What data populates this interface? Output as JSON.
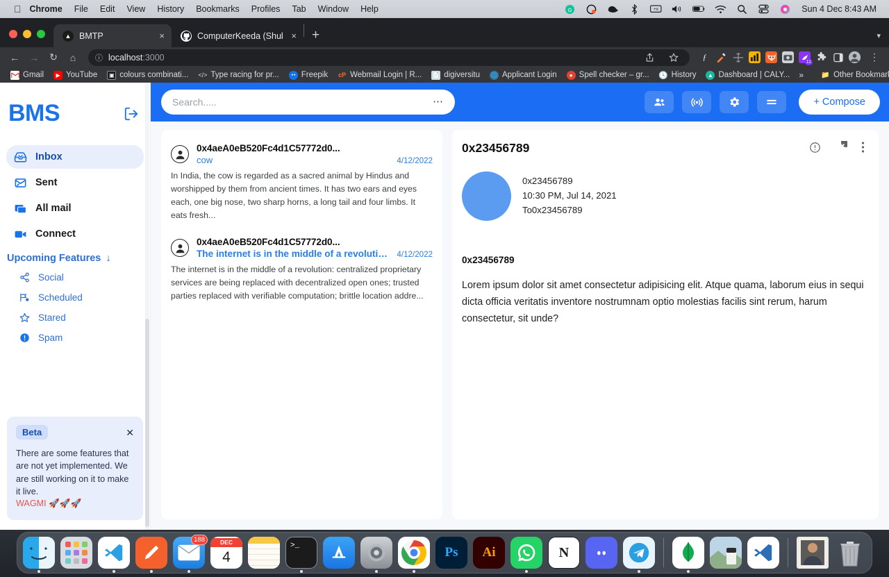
{
  "os": {
    "menu": {
      "apple_icon": "apple-logo-icon",
      "items": [
        "Chrome",
        "File",
        "Edit",
        "View",
        "History",
        "Bookmarks",
        "Profiles",
        "Tab",
        "Window",
        "Help"
      ],
      "status_icons": [
        "grammarly-icon",
        "cleanshot-icon",
        "bluetooth-icon",
        "battery-percent-icon",
        "volume-icon",
        "battery-icon",
        "wifi-icon",
        "spotlight-search-icon",
        "control-center-icon",
        "siri-icon"
      ],
      "clock": "Sun 4 Dec  8:43 AM"
    }
  },
  "browser": {
    "tabs": [
      {
        "title": "BMTP",
        "favicon": "bmtp-triangle-icon",
        "active": true,
        "close": "×"
      },
      {
        "title": "ComputerKeeda (Shubham Sha",
        "favicon": "github-icon",
        "active": false,
        "close": "×"
      }
    ],
    "new_tab_label": "+",
    "nav": {
      "back": "←",
      "forward": "→",
      "reload": "↻",
      "home": "⌂"
    },
    "omnibox": {
      "security_icon": "info-circle-icon",
      "url_host": "localhost",
      "url_rest": ":3000",
      "share_icon": "share-icon",
      "bookmark_icon": "star-icon"
    },
    "extensions": [
      "font-finder-icon",
      "colorpick-icon",
      "ruler-icon",
      "analytics-icon",
      "fox-icon",
      "camera-icon",
      "purple-ext-icon",
      "puzzle-icon",
      "sidepanel-icon",
      "profile-avatar-icon",
      "kebab-menu-icon"
    ],
    "extension_badge": "11",
    "bookmarks": [
      {
        "label": "Gmail",
        "icon": "gmail-icon"
      },
      {
        "label": "YouTube",
        "icon": "youtube-icon"
      },
      {
        "label": "colours combinati...",
        "icon": "colours-icon"
      },
      {
        "label": "Type racing for pr...",
        "icon": "code-icon"
      },
      {
        "label": "Freepik",
        "icon": "freepik-icon"
      },
      {
        "label": "Webmail Login | R...",
        "icon": "cpanel-icon"
      },
      {
        "label": "digiversitu",
        "icon": "document-icon"
      },
      {
        "label": "Applicant Login",
        "icon": "globe-icon"
      },
      {
        "label": "Spell checker – gr...",
        "icon": "grammarly-icon"
      },
      {
        "label": "History",
        "icon": "clock-icon"
      },
      {
        "label": "Dashboard | CALY...",
        "icon": "caly-icon"
      }
    ],
    "bookmarks_overflow": "»",
    "other_bookmarks": {
      "label": "Other Bookmarks",
      "icon": "folder-icon"
    }
  },
  "app": {
    "sidebar": {
      "brand": "BMS",
      "logout_icon": "logout-icon",
      "nav": [
        {
          "label": "Inbox",
          "icon": "inbox-icon",
          "active": true
        },
        {
          "label": "Sent",
          "icon": "sent-icon",
          "active": false
        },
        {
          "label": "All mail",
          "icon": "all-mail-icon",
          "active": false
        },
        {
          "label": "Connect",
          "icon": "video-camera-icon",
          "active": false
        }
      ],
      "upcoming": {
        "label": "Upcoming Features",
        "arrow": "↓"
      },
      "sub_nav": [
        {
          "label": "Social",
          "icon": "share-nodes-icon"
        },
        {
          "label": "Scheduled",
          "icon": "scheduled-icon"
        },
        {
          "label": "Stared",
          "icon": "star-outline-icon"
        },
        {
          "label": "Spam",
          "icon": "exclamation-circle-icon"
        }
      ],
      "beta": {
        "badge": "Beta",
        "close": "✕",
        "text": "There are some features that are not yet implemented. We are still working on it to make it live.",
        "wagmi": "WAGMI 🚀🚀🚀"
      }
    },
    "topbar": {
      "search_value": "Search.....",
      "search_dots": "⋯",
      "actions": [
        {
          "icon": "people-group-icon",
          "name": "contacts-button"
        },
        {
          "icon": "broadcast-icon",
          "name": "broadcast-button"
        },
        {
          "icon": "gear-icon",
          "name": "settings-button"
        },
        {
          "icon": "menu-equals-icon",
          "name": "menu-button"
        }
      ],
      "compose_label": "+ Compose"
    },
    "mail_list": [
      {
        "address": "0x4aeA0eB520Fc4d1C57772d0...",
        "subject": "cow",
        "subject_bold": false,
        "date": "4/12/2022",
        "snippet": "In India, the cow is regarded as a sacred animal by Hindus and worshipped by them from ancient times. It has two ears and eyes each, one big nose, two sharp horns, a long tail and four limbs. It eats fresh..."
      },
      {
        "address": "0x4aeA0eB520Fc4d1C57772d0...",
        "subject": "The internet is in the middle of a revolution:",
        "subject_bold": true,
        "date": "4/12/2022",
        "snippet": "The internet is in the middle of a revolution: centralized proprietary services are being replaced with decentralized open ones; trusted parties replaced with verifiable computation; brittle location addre..."
      }
    ],
    "reading_pane": {
      "title": "0x23456789",
      "actions": [
        {
          "icon": "info-circle-icon",
          "name": "info-button"
        },
        {
          "icon": "edit-pencil-icon",
          "name": "edit-button"
        },
        {
          "icon": "kebab-menu-icon",
          "name": "more-options-button"
        }
      ],
      "from": "0x23456789",
      "timestamp": "10:30 PM, Jul 14, 2021",
      "to": "To0x23456789",
      "subject": "0x23456789",
      "body": "Lorem ipsum dolor sit amet consectetur adipisicing elit. Atque quama, laborum eius in sequi dicta officia veritatis inventore nostrumnam optio molestias facilis sint rerum, harum consectetur, sit unde?"
    }
  },
  "dock": {
    "items": [
      {
        "name": "finder",
        "icon": "finder-icon",
        "running": true
      },
      {
        "name": "launchpad",
        "icon": "launchpad-icon",
        "running": false
      },
      {
        "name": "vscode",
        "icon": "vscode-icon",
        "running": true
      },
      {
        "name": "postman",
        "icon": "postman-icon",
        "running": true
      },
      {
        "name": "mail",
        "icon": "mail-icon",
        "running": true,
        "badge": "188"
      },
      {
        "name": "calendar",
        "icon": "calendar-icon",
        "running": false,
        "month": "DEC",
        "day": "4"
      },
      {
        "name": "notes",
        "icon": "notes-icon",
        "running": false
      },
      {
        "name": "terminal",
        "icon": "terminal-icon",
        "running": true
      },
      {
        "name": "app-store",
        "icon": "app-store-icon",
        "running": false
      },
      {
        "name": "system-preferences",
        "icon": "system-preferences-icon",
        "running": true
      },
      {
        "name": "chrome",
        "icon": "chrome-icon",
        "running": true
      },
      {
        "name": "photoshop",
        "icon": "photoshop-icon",
        "running": false
      },
      {
        "name": "illustrator",
        "icon": "illustrator-icon",
        "running": false
      },
      {
        "name": "whatsapp",
        "icon": "whatsapp-icon",
        "running": true
      },
      {
        "name": "notion",
        "icon": "notion-icon",
        "running": false
      },
      {
        "name": "discord",
        "icon": "discord-icon",
        "running": false
      },
      {
        "name": "telegram",
        "icon": "telegram-icon",
        "running": true
      },
      {
        "name": "mongodb",
        "icon": "mongodb-icon",
        "running": true
      },
      {
        "name": "preview-image",
        "icon": "preview-image-icon",
        "running": false
      },
      {
        "name": "vscode-insiders",
        "icon": "vscode-insiders-icon",
        "running": false
      },
      {
        "name": "photo-file",
        "icon": "photo-file-icon",
        "running": false
      },
      {
        "name": "trash",
        "icon": "trash-icon",
        "running": false
      }
    ]
  }
}
